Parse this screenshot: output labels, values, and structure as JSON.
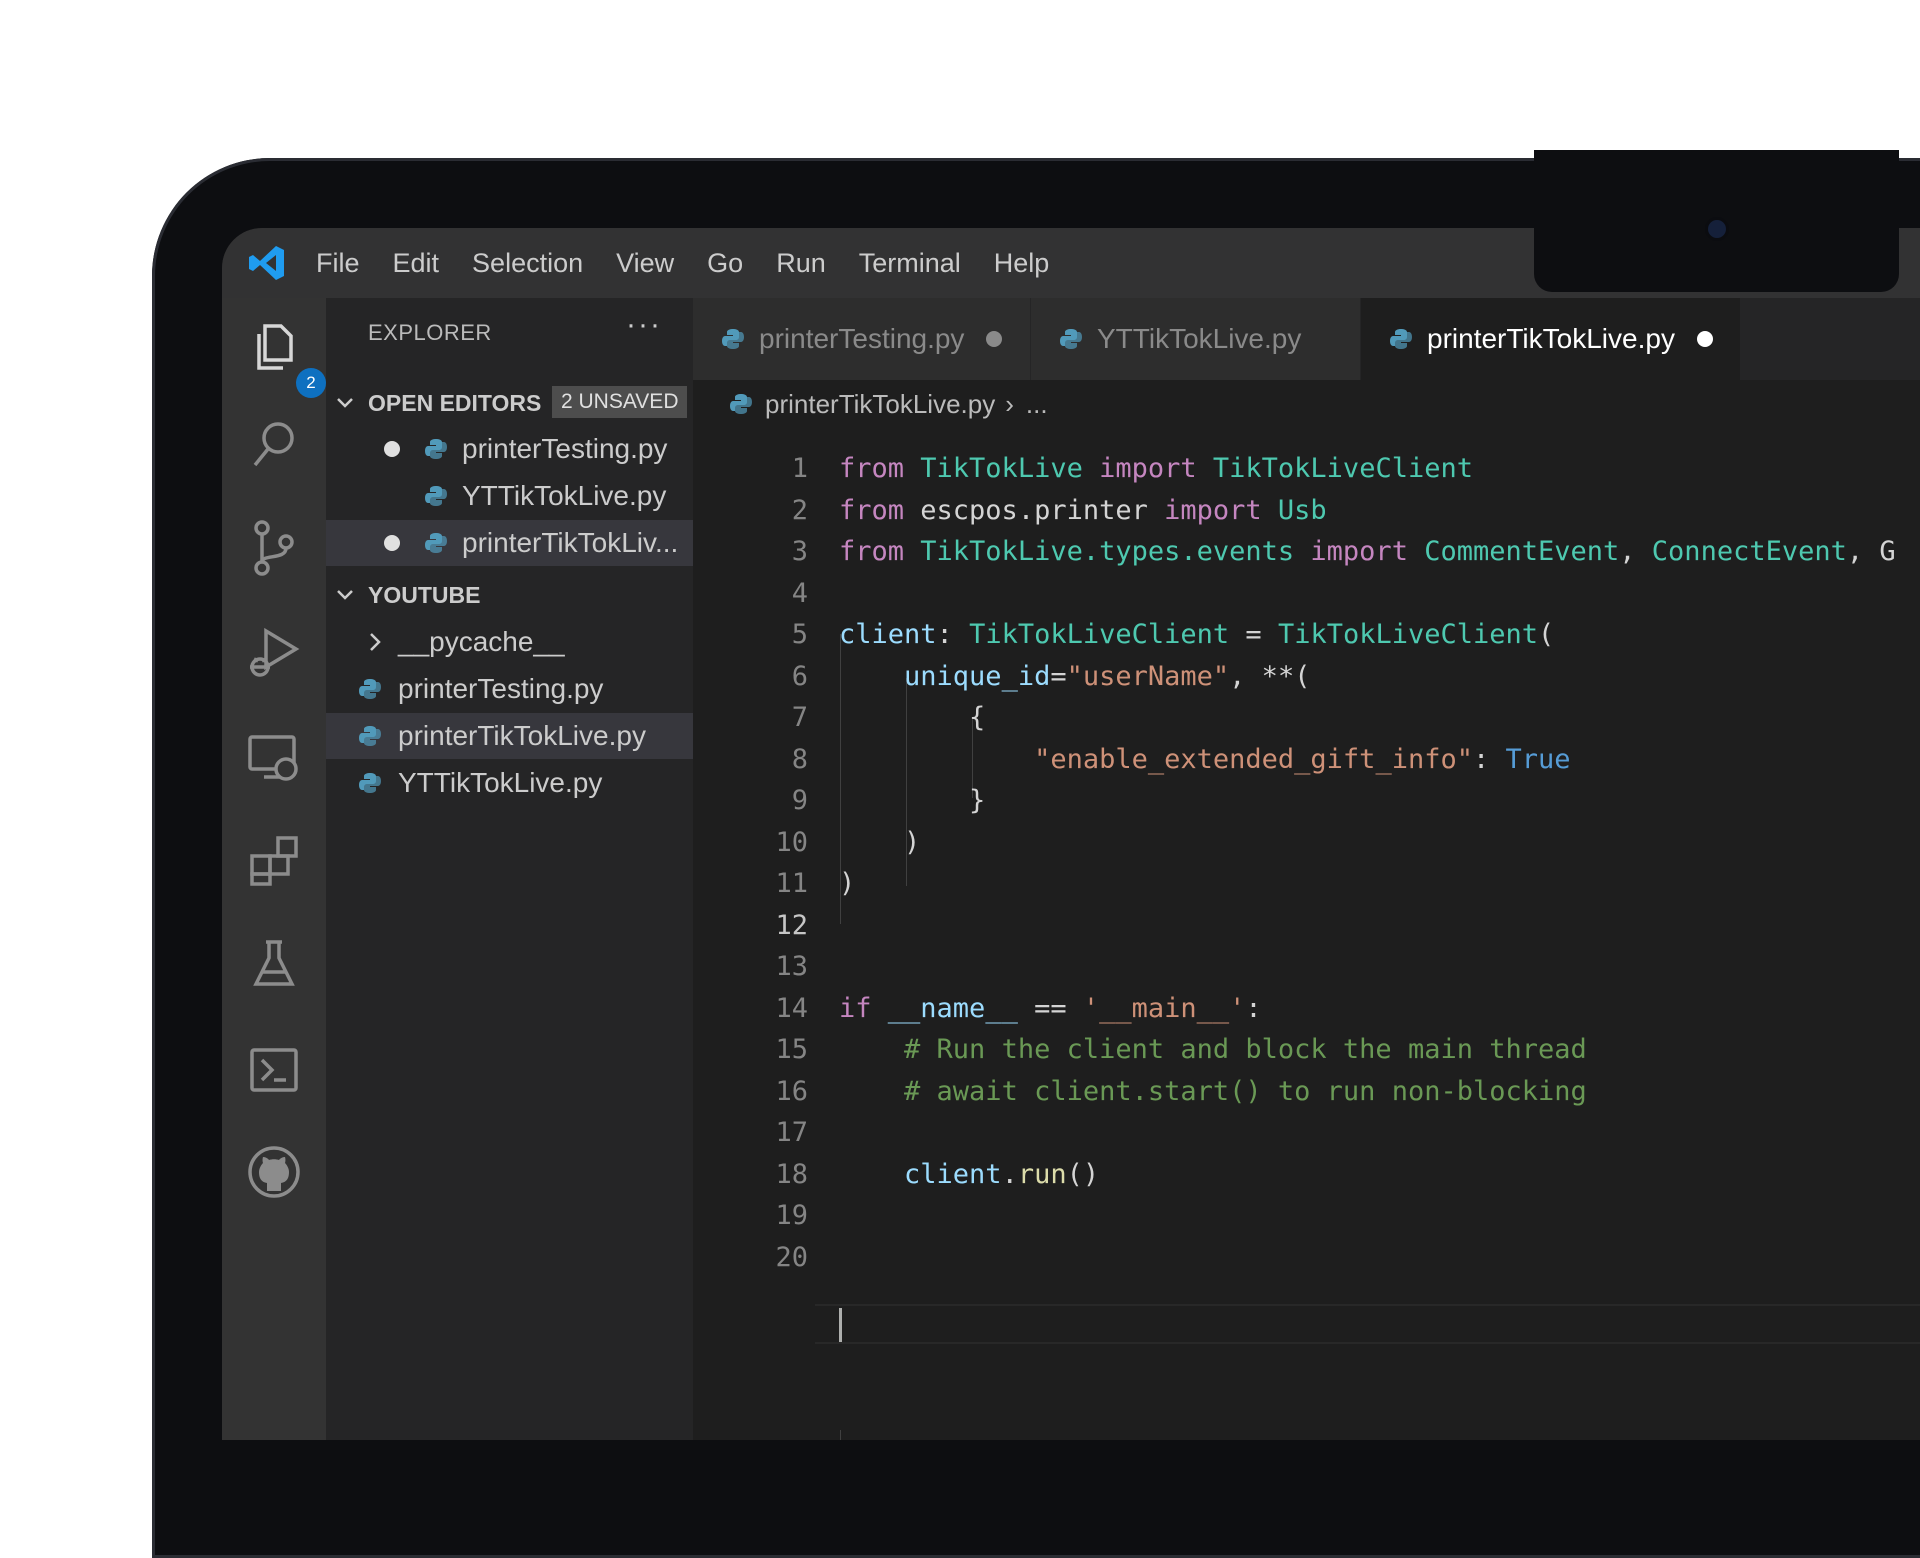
{
  "menu": [
    "File",
    "Edit",
    "Selection",
    "View",
    "Go",
    "Run",
    "Terminal",
    "Help"
  ],
  "activity": {
    "explorer_badge": "2"
  },
  "sidebar": {
    "title": "EXPLORER",
    "more": "···",
    "open_editors": {
      "label": "OPEN EDITORS",
      "badge": "2 UNSAVED",
      "items": [
        {
          "name": "printerTesting.py",
          "unsaved": true
        },
        {
          "name": "YTTikTokLive.py",
          "unsaved": false
        },
        {
          "name": "printerTikTokLiv...",
          "unsaved": true
        }
      ]
    },
    "folder": {
      "label": "YOUTUBE",
      "items": [
        "__pycache__",
        "printerTesting.py",
        "printerTikTokLive.py",
        "YTTikTokLive.py"
      ]
    }
  },
  "tabs": [
    {
      "name": "printerTesting.py",
      "unsaved": true,
      "active": false
    },
    {
      "name": "YTTikTokLive.py",
      "unsaved": false,
      "active": false
    },
    {
      "name": "printerTikTokLive.py",
      "unsaved": true,
      "active": true
    }
  ],
  "breadcrumb": {
    "file": "printerTikTokLive.py",
    "sep": "›",
    "rest": "..."
  },
  "editor": {
    "current_line": 12,
    "lines": [
      [
        [
          "kw",
          "from "
        ],
        [
          "cls",
          "TikTokLive"
        ],
        [
          "kw",
          " import "
        ],
        [
          "cls",
          "TikTokLiveClient"
        ]
      ],
      [
        [
          "kw",
          "from "
        ],
        [
          "pl",
          "escpos.printer"
        ],
        [
          "kw",
          " import "
        ],
        [
          "cls",
          "Usb"
        ]
      ],
      [
        [
          "kw",
          "from "
        ],
        [
          "cls",
          "TikTokLive.types.events"
        ],
        [
          "kw",
          " import "
        ],
        [
          "cls",
          "CommentEvent"
        ],
        [
          "pl",
          ", "
        ],
        [
          "cls",
          "ConnectEvent"
        ],
        [
          "pl",
          ", G"
        ]
      ],
      [],
      [
        [
          "var",
          "client"
        ],
        [
          "pl",
          ": "
        ],
        [
          "cls",
          "TikTokLiveClient"
        ],
        [
          "pl",
          " = "
        ],
        [
          "cls",
          "TikTokLiveClient"
        ],
        [
          "pl",
          "("
        ]
      ],
      [
        [
          "pl",
          "    "
        ],
        [
          "var",
          "unique_id"
        ],
        [
          "pl",
          "="
        ],
        [
          "str",
          "\"userName\""
        ],
        [
          "pl",
          ", **("
        ]
      ],
      [
        [
          "pl",
          "        {"
        ]
      ],
      [
        [
          "pl",
          "            "
        ],
        [
          "str",
          "\"enable_extended_gift_info\""
        ],
        [
          "pl",
          ": "
        ],
        [
          "bool",
          "True"
        ]
      ],
      [
        [
          "pl",
          "        }"
        ]
      ],
      [
        [
          "pl",
          "    )"
        ]
      ],
      [
        [
          "pl",
          ")"
        ]
      ],
      [],
      [],
      [
        [
          "kw",
          "if "
        ],
        [
          "var",
          "__name__"
        ],
        [
          "pl",
          " == "
        ],
        [
          "str",
          "'__main__'"
        ],
        [
          "pl",
          ":"
        ]
      ],
      [
        [
          "pl",
          "    "
        ],
        [
          "cmt",
          "# Run the client and block the main thread"
        ]
      ],
      [
        [
          "pl",
          "    "
        ],
        [
          "cmt",
          "# await client.start() to run non-blocking"
        ]
      ],
      [],
      [
        [
          "pl",
          "    "
        ],
        [
          "var",
          "client"
        ],
        [
          "pl",
          "."
        ],
        [
          "fn",
          "run"
        ],
        [
          "pl",
          "()"
        ]
      ],
      [],
      []
    ]
  }
}
